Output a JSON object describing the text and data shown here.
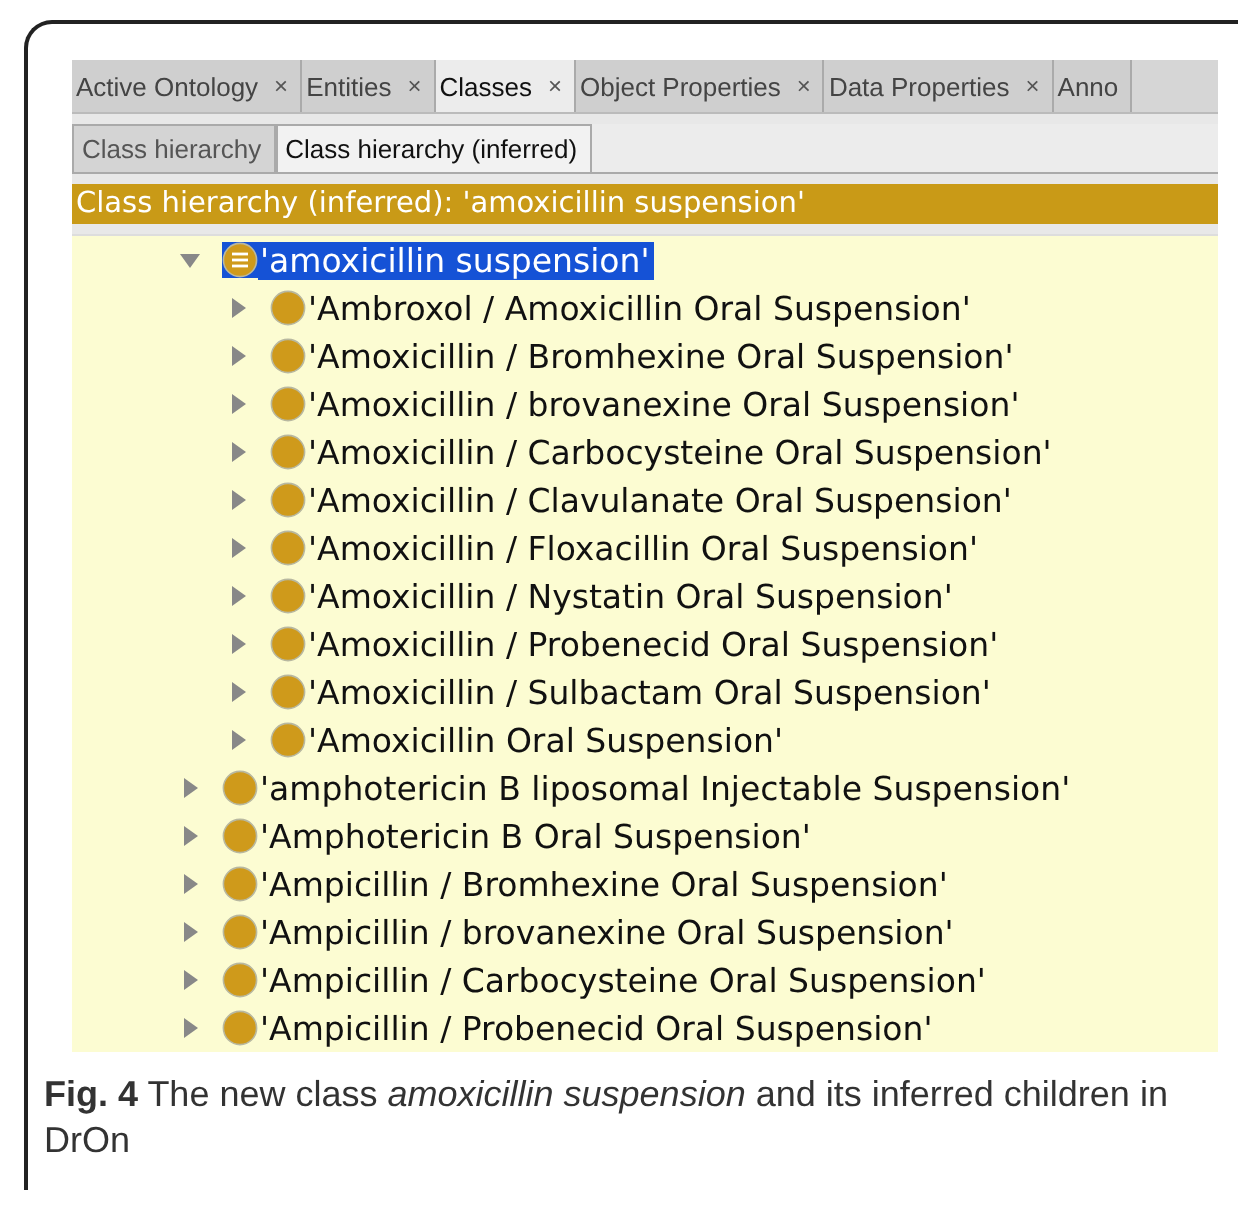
{
  "tabs": [
    {
      "label": "Active Ontology",
      "close": "×",
      "selected": false
    },
    {
      "label": "Entities",
      "close": "×",
      "selected": false
    },
    {
      "label": "Classes",
      "close": "×",
      "selected": true
    },
    {
      "label": "Object Properties",
      "close": "×",
      "selected": false
    },
    {
      "label": "Data Properties",
      "close": "×",
      "selected": false
    },
    {
      "label": "Anno",
      "selected": false
    }
  ],
  "subtabs": [
    {
      "label": "Class hierarchy",
      "selected": false
    },
    {
      "label": "Class hierarchy (inferred)",
      "selected": true
    }
  ],
  "view_title": "Class hierarchy (inferred): 'amoxicillin suspension'",
  "tree": [
    {
      "label": "'amoxicillin suspension'",
      "kind": "defined",
      "expanded": true,
      "selected": true,
      "children": [
        {
          "label": "'Ambroxol / Amoxicillin Oral Suspension'",
          "kind": "primitive",
          "expanded": false,
          "selected": false
        },
        {
          "label": "'Amoxicillin / Bromhexine Oral Suspension'",
          "kind": "primitive",
          "expanded": false,
          "selected": false
        },
        {
          "label": "'Amoxicillin / brovanexine Oral Suspension'",
          "kind": "primitive",
          "expanded": false,
          "selected": false
        },
        {
          "label": "'Amoxicillin / Carbocysteine Oral Suspension'",
          "kind": "primitive",
          "expanded": false,
          "selected": false
        },
        {
          "label": "'Amoxicillin / Clavulanate Oral Suspension'",
          "kind": "primitive",
          "expanded": false,
          "selected": false
        },
        {
          "label": "'Amoxicillin / Floxacillin Oral Suspension'",
          "kind": "primitive",
          "expanded": false,
          "selected": false
        },
        {
          "label": "'Amoxicillin / Nystatin Oral Suspension'",
          "kind": "primitive",
          "expanded": false,
          "selected": false
        },
        {
          "label": "'Amoxicillin / Probenecid Oral Suspension'",
          "kind": "primitive",
          "expanded": false,
          "selected": false
        },
        {
          "label": "'Amoxicillin / Sulbactam Oral Suspension'",
          "kind": "primitive",
          "expanded": false,
          "selected": false
        },
        {
          "label": "'Amoxicillin Oral Suspension'",
          "kind": "primitive",
          "expanded": false,
          "selected": false
        }
      ]
    },
    {
      "label": "'amphotericin B liposomal Injectable Suspension'",
      "kind": "primitive",
      "expanded": false,
      "selected": false
    },
    {
      "label": "'Amphotericin B Oral Suspension'",
      "kind": "primitive",
      "expanded": false,
      "selected": false
    },
    {
      "label": "'Ampicillin / Bromhexine Oral Suspension'",
      "kind": "primitive",
      "expanded": false,
      "selected": false
    },
    {
      "label": "'Ampicillin / brovanexine Oral Suspension'",
      "kind": "primitive",
      "expanded": false,
      "selected": false
    },
    {
      "label": "'Ampicillin / Carbocysteine Oral Suspension'",
      "kind": "primitive",
      "expanded": false,
      "selected": false
    },
    {
      "label": "'Ampicillin / Probenecid Oral Suspension'",
      "kind": "primitive",
      "expanded": false,
      "selected": false
    }
  ],
  "caption": "**Fig. 4** The new class *amoxicillin suspension* and its inferred children in DrOn"
}
